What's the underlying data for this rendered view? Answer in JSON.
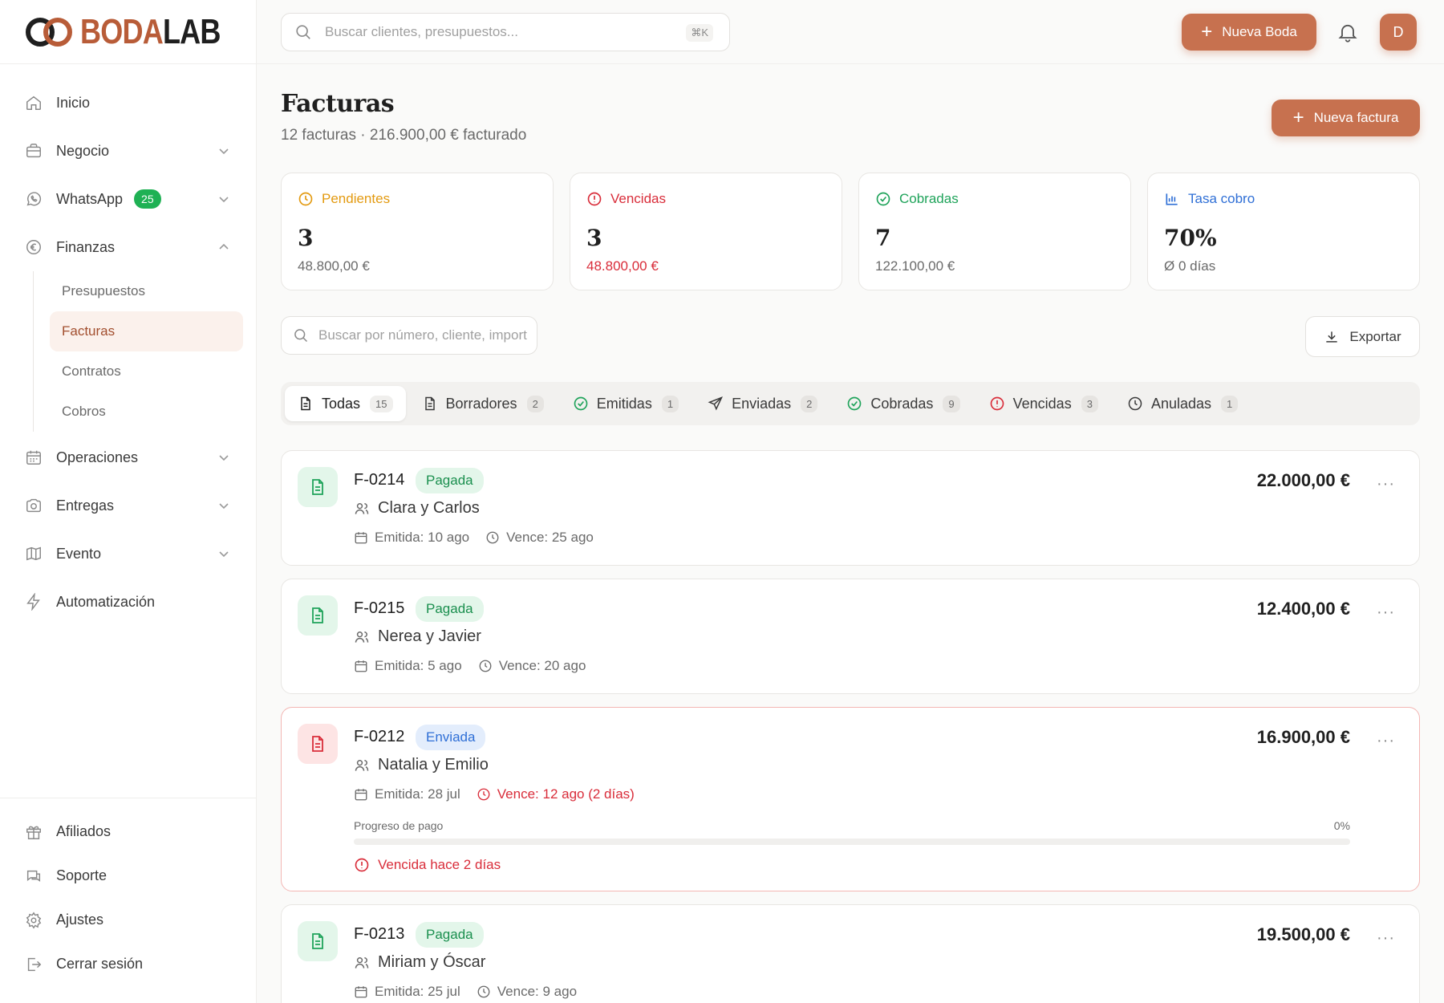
{
  "brand": {
    "part1": "BODA",
    "part2": "LAB",
    "accent": "#c7714f"
  },
  "topbar": {
    "search_placeholder": "Buscar clientes, presupuestos...",
    "shortcut": "⌘K",
    "new_wedding_label": "Nueva Boda",
    "avatar_initial": "D"
  },
  "sidebar": {
    "items": [
      {
        "label": "Inicio",
        "icon": "home-icon"
      },
      {
        "label": "Negocio",
        "icon": "briefcase-icon"
      },
      {
        "label": "WhatsApp",
        "icon": "whatsapp-icon",
        "badge": "25"
      },
      {
        "label": "Finanzas",
        "icon": "euro-icon"
      },
      {
        "label": "Operaciones",
        "icon": "calendar-icon"
      },
      {
        "label": "Entregas",
        "icon": "camera-icon"
      },
      {
        "label": "Evento",
        "icon": "map-icon"
      },
      {
        "label": "Automatización",
        "icon": "bolt-icon"
      }
    ],
    "finanzas_sub": [
      "Presupuestos",
      "Facturas",
      "Contratos",
      "Cobros"
    ],
    "bottom": [
      {
        "label": "Afiliados",
        "icon": "gift-icon"
      },
      {
        "label": "Soporte",
        "icon": "chat-icon"
      },
      {
        "label": "Ajustes",
        "icon": "gear-icon"
      },
      {
        "label": "Cerrar sesión",
        "icon": "logout-icon"
      }
    ]
  },
  "page": {
    "title": "Facturas",
    "subtitle": "12 facturas · 216.900,00 € facturado",
    "new_invoice_label": "Nueva factura",
    "list_search_placeholder": "Buscar por número, cliente, importe...",
    "export_label": "Exportar"
  },
  "stats": [
    {
      "label": "Pendientes",
      "value": "3",
      "amount": "48.800,00 €",
      "color": "#e39a10"
    },
    {
      "label": "Vencidas",
      "value": "3",
      "amount": "48.800,00 €",
      "color": "#d92d3a"
    },
    {
      "label": "Cobradas",
      "value": "7",
      "amount": "122.100,00 €",
      "color": "#1fa35a"
    },
    {
      "label": "Tasa cobro",
      "value": "70%",
      "amount": "Ø 0 días",
      "color": "#2f6fd6"
    }
  ],
  "tabs": [
    {
      "label": "Todas",
      "count": "15"
    },
    {
      "label": "Borradores",
      "count": "2"
    },
    {
      "label": "Emitidas",
      "count": "1"
    },
    {
      "label": "Enviadas",
      "count": "2"
    },
    {
      "label": "Cobradas",
      "count": "9"
    },
    {
      "label": "Vencidas",
      "count": "3"
    },
    {
      "label": "Anuladas",
      "count": "1"
    }
  ],
  "invoices": [
    {
      "number": "F-0214",
      "status": "Pagada",
      "client": "Clara y Carlos",
      "issued": "Emitida: 10 ago",
      "due": "Vence: 25 ago",
      "amount": "22.000,00 €"
    },
    {
      "number": "F-0215",
      "status": "Pagada",
      "client": "Nerea y Javier",
      "issued": "Emitida: 5 ago",
      "due": "Vence: 20 ago",
      "amount": "12.400,00 €"
    },
    {
      "number": "F-0212",
      "status": "Enviada",
      "client": "Natalia y Emilio",
      "issued": "Emitida: 28 jul",
      "due": "Vence: 12 ago (2 días)",
      "amount": "16.900,00 €",
      "progress_label": "Progreso de pago",
      "progress_pct": "0%",
      "progress_value": 0,
      "overdue_msg": "Vencida hace 2 días"
    },
    {
      "number": "F-0213",
      "status": "Pagada",
      "client": "Miriam y Óscar",
      "issued": "Emitida: 25 jul",
      "due": "Vence: 9 ago",
      "amount": "19.500,00 €"
    }
  ],
  "more_label": "···"
}
